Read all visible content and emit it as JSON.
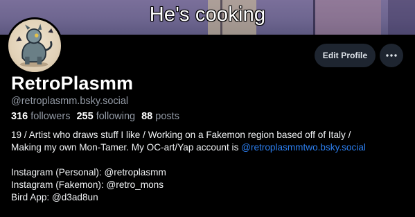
{
  "banner": {
    "caption": "He's cooking"
  },
  "actions": {
    "edit_profile": "Edit Profile",
    "more_label": "More options"
  },
  "profile": {
    "display_name": "RetroPlasmm",
    "handle": "@retroplasmm.bsky.social"
  },
  "stats": {
    "followers_count": "316",
    "followers_label": "followers",
    "following_count": "255",
    "following_label": "following",
    "posts_count": "88",
    "posts_label": "posts"
  },
  "bio": {
    "line1": "19 / Artist who draws stuff I like / Working on a Fakemon region based off of Italy /",
    "line2_text": "Making my own Mon-Tamer. My OC-art/Yap account is ",
    "line2_link": "@retroplasmmtwo.bsky.social",
    "line3": "Instagram (Personal): @retroplasmm",
    "line4": "Instagram (Fakemon): @retro_mons",
    "line5": "Bird App: @d3ad8un"
  },
  "colors": {
    "link": "#2c7ff0",
    "button_bg": "#1e2530",
    "muted_text": "#939aa5",
    "background": "#000000"
  },
  "icons": {
    "more": "ellipsis-icon"
  }
}
